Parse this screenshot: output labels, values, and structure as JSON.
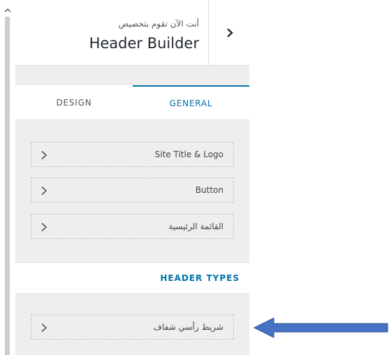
{
  "header": {
    "subtitle": "أنت الآن تقوم بتخصيص",
    "title": "Header Builder"
  },
  "tabs": [
    {
      "label": "DESIGN",
      "active": false
    },
    {
      "label": "GENERAL",
      "active": true
    }
  ],
  "items": [
    {
      "label": "Site Title & Logo"
    },
    {
      "label": "Button"
    },
    {
      "label": "القائمة الرئيسية"
    }
  ],
  "section": {
    "title": "HEADER TYPES",
    "items": [
      {
        "label": "شريط رأسي شفاف"
      }
    ]
  },
  "colors": {
    "accent": "#0073aa",
    "panel_bg": "#eeeeee",
    "annotation_arrow": "#4472c4"
  },
  "icons": {
    "back": "chevron-right-icon",
    "item": "chevron-right-icon",
    "scroll": "chevron-up-icon",
    "annotation": "left-arrow-icon"
  }
}
